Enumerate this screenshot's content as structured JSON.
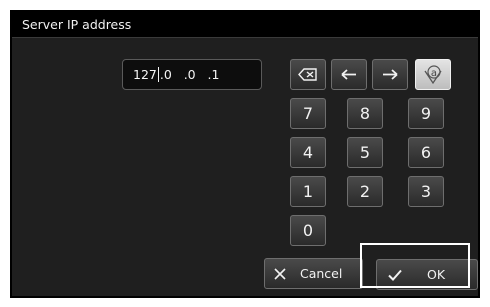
{
  "dialog": {
    "title": "Server IP address"
  },
  "ip_field": {
    "value_before_caret": "127",
    "value_after_caret": ".0   .0   .1"
  },
  "keypad": {
    "backspace_icon": "backspace-icon",
    "left_icon": "arrow-left-icon",
    "right_icon": "arrow-right-icon",
    "alpha_icon": "alphabet-mode-icon",
    "alpha_glyph": "a",
    "digits": {
      "k7": "7",
      "k8": "8",
      "k9": "9",
      "k4": "4",
      "k5": "5",
      "k6": "6",
      "k1": "1",
      "k2": "2",
      "k3": "3",
      "k0": "0"
    }
  },
  "buttons": {
    "cancel_label": "Cancel",
    "ok_label": "OK"
  },
  "colors": {
    "panel_background": "#1f1f1f",
    "titlebar_background": "#000000",
    "key_face": "#3a3a3a",
    "alpha_key_face": "#d0d0d0",
    "focus_frame": "#ffffff"
  }
}
